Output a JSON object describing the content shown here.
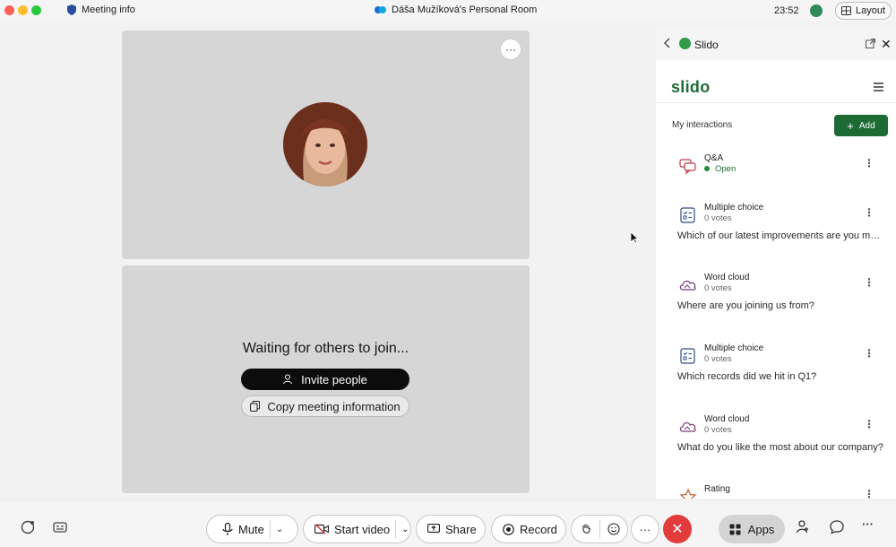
{
  "topbar": {
    "meeting_info": "Meeting info",
    "room_title": "Dáša Mužíková's Personal Room",
    "clock": "23:52",
    "layout_label": "Layout"
  },
  "stage": {
    "more_label": "···",
    "waiting_text": "Waiting for others to join...",
    "invite_label": "Invite people",
    "copy_label": "Copy meeting information"
  },
  "panel": {
    "title": "Slido",
    "brand": "slido",
    "my_interactions": "My interactions",
    "add_label": "Add",
    "items": [
      {
        "title": "Q&A",
        "sub": "Open",
        "question": ""
      },
      {
        "title": "Multiple choice",
        "sub": "0 votes",
        "question": "Which of our latest improvements are you most excited about?"
      },
      {
        "title": "Word cloud",
        "sub": "0 votes",
        "question": "Where are you joining us from?"
      },
      {
        "title": "Multiple choice",
        "sub": "0 votes",
        "question": "Which records did we hit in Q1?"
      },
      {
        "title": "Word cloud",
        "sub": "0 votes",
        "question": "What do you like the most about our company?"
      },
      {
        "title": "Rating",
        "sub": "",
        "question": ""
      }
    ]
  },
  "bottombar": {
    "mute_label": "Mute",
    "video_label": "Start video",
    "share_label": "Share",
    "record_label": "Record",
    "more_label": "···",
    "end_label": "✕",
    "apps_label": "Apps",
    "overflow_label": "···"
  },
  "colors": {
    "slido_green": "#1d6b34",
    "end_red": "#e23b3b",
    "stage_tile": "#d6d6d6"
  }
}
